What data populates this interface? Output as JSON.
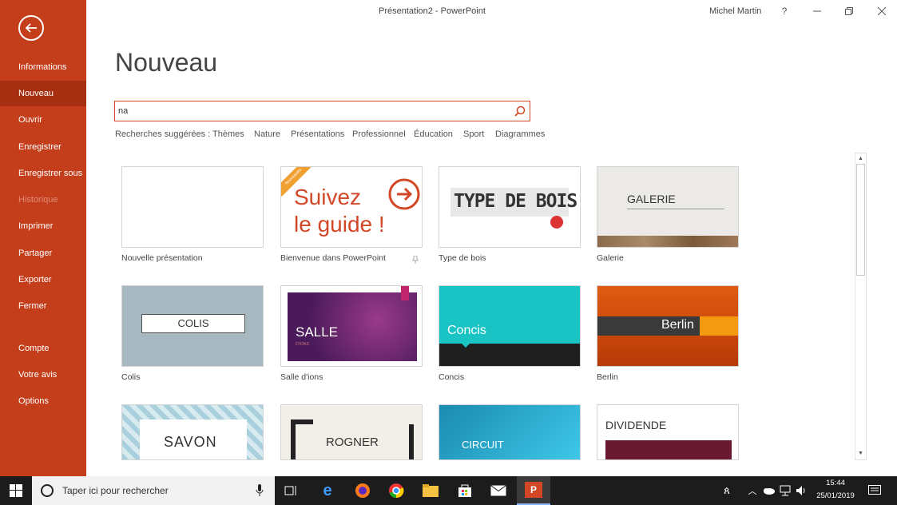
{
  "window": {
    "title": "Présentation2  -  PowerPoint",
    "user": "Michel Martin",
    "help": "?"
  },
  "sidebar": {
    "items": [
      {
        "label": "Informations"
      },
      {
        "label": "Nouveau"
      },
      {
        "label": "Ouvrir"
      },
      {
        "label": "Enregistrer"
      },
      {
        "label": "Enregistrer sous"
      },
      {
        "label": "Historique"
      },
      {
        "label": "Imprimer"
      },
      {
        "label": "Partager"
      },
      {
        "label": "Exporter"
      },
      {
        "label": "Fermer"
      },
      {
        "label": "Compte"
      },
      {
        "label": "Votre avis"
      },
      {
        "label": "Options"
      }
    ]
  },
  "main": {
    "title": "Nouveau",
    "search_value": "na",
    "suggested_label": "Recherches suggérées :",
    "suggestions": [
      "Thèmes",
      "Nature",
      "Présentations",
      "Professionnel",
      "Éducation",
      "Sport",
      "Diagrammes"
    ]
  },
  "templates": [
    {
      "caption": "Nouvelle présentation"
    },
    {
      "caption": "Bienvenue dans PowerPoint",
      "line1": "Suivez",
      "line2": "le guide !",
      "ribbon": "Nouveautés"
    },
    {
      "caption": "Type de bois",
      "thumb": "TYPE DE BOIS"
    },
    {
      "caption": "Galerie",
      "thumb": "GALERIE"
    },
    {
      "caption": "Colis",
      "thumb": "COLIS"
    },
    {
      "caption": "Salle d'ions",
      "thumb": "SALLE",
      "sub": "D'IONS"
    },
    {
      "caption": "Concis",
      "thumb": "Concis"
    },
    {
      "caption": "Berlin",
      "thumb": "Berlin"
    },
    {
      "thumb": "SAVON"
    },
    {
      "thumb": "ROGNER"
    },
    {
      "thumb": "CIRCUIT"
    },
    {
      "thumb": "DIVIDENDE"
    }
  ],
  "taskbar": {
    "search_placeholder": "Taper ici pour rechercher",
    "time": "15:44",
    "date": "25/01/2019"
  },
  "colors": {
    "accent": "#c43e1c",
    "accent_active": "#a52f10"
  }
}
